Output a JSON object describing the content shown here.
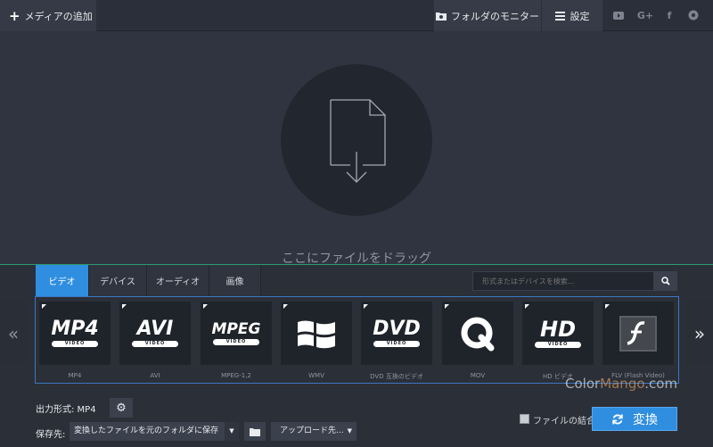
{
  "toolbar": {
    "add_media": "メディアの追加",
    "folder_monitor": "フォルダのモニター",
    "settings": "設定",
    "social": [
      "youtube-icon",
      "google-plus-icon",
      "facebook-icon",
      "vk-icon"
    ]
  },
  "dropzone": {
    "text": "ここにファイルをドラッグ"
  },
  "tabs": [
    {
      "label": "ビデオ",
      "active": true
    },
    {
      "label": "デバイス",
      "active": false
    },
    {
      "label": "オーディオ",
      "active": false
    },
    {
      "label": "画像",
      "active": false
    }
  ],
  "search": {
    "placeholder": "形式またはデバイスを検索..."
  },
  "formats": [
    {
      "logo": "MP4",
      "sub": "VIDEO",
      "label": "MP4"
    },
    {
      "logo": "AVI",
      "sub": "VIDEO",
      "label": "AVI"
    },
    {
      "logo": "MPEG",
      "sub": "VIDEO",
      "label": "MPEG-1,2"
    },
    {
      "logo": "windows-icon",
      "sub": "",
      "label": "WMV"
    },
    {
      "logo": "DVD",
      "sub": "VIDEO",
      "label": "DVD 互換のビデオ"
    },
    {
      "logo": "quicktime-icon",
      "sub": "",
      "label": "MOV"
    },
    {
      "logo": "HD",
      "sub": "VIDEO",
      "label": "HD ビデオ"
    },
    {
      "logo": "flash-icon",
      "sub": "",
      "label": "FLV (Flash Video)"
    }
  ],
  "bottom": {
    "output_format_label": "出力形式: MP4",
    "save_label": "保存先:",
    "save_value": "変換したファイルを元のフォルダに保存",
    "upload_label": "アップロード先...",
    "merge_label": "ファイルの結合",
    "merge_checked": false,
    "convert_label": "変換"
  },
  "watermark": {
    "left": "Color",
    "mid": "Mango",
    "right": ".com"
  },
  "colors": {
    "accent": "#2f8ee0",
    "green_line": "#2e9a73",
    "background": "#2f3440"
  }
}
